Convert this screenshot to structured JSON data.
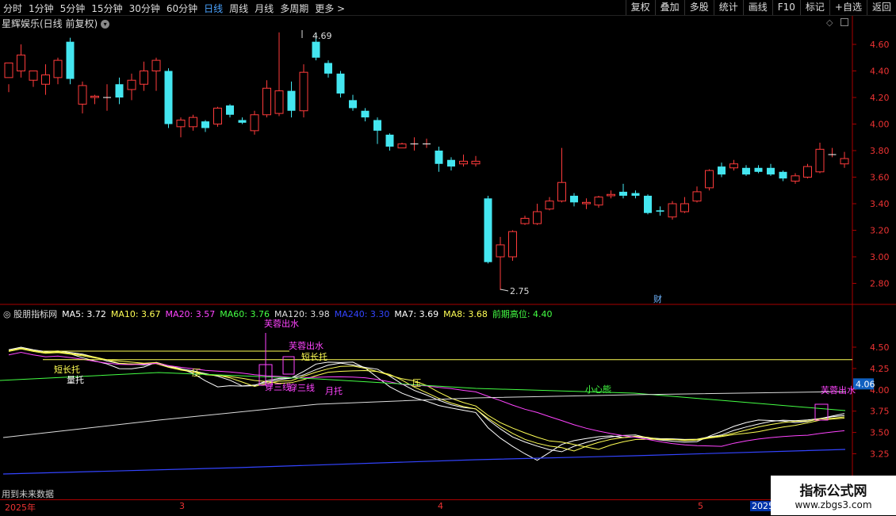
{
  "toolbar": {
    "periods": [
      "分时",
      "1分钟",
      "5分钟",
      "15分钟",
      "30分钟",
      "60分钟",
      "日线",
      "周线",
      "月线",
      "多周期",
      "更多 >"
    ],
    "active_index": 6,
    "right_buttons": [
      "复权",
      "叠加",
      "多股",
      "统计",
      "画线",
      "F10",
      "标记",
      "+自选",
      "返回"
    ]
  },
  "main_chart": {
    "title": "星辉娱乐(日线 前复权)",
    "y_ticks": [
      "4.60",
      "4.40",
      "4.20",
      "4.00",
      "3.80",
      "3.60",
      "3.40",
      "3.20",
      "3.00",
      "2.80"
    ],
    "high_label": "4.69",
    "low_label": "2.75",
    "fin_marker": "财",
    "candles": [
      [
        4.35,
        4.46,
        4.3,
        4.24
      ],
      [
        4.4,
        4.52,
        4.6,
        4.35
      ],
      [
        4.33,
        4.4,
        4.35,
        4.28
      ],
      [
        4.3,
        4.37,
        4.45,
        4.22
      ],
      [
        4.35,
        4.48,
        4.5,
        4.3
      ],
      [
        4.62,
        4.34,
        4.65,
        4.3
      ],
      [
        4.15,
        4.29,
        4.32,
        4.08
      ],
      [
        4.2,
        4.21,
        4.22,
        4.15
      ],
      [
        4.2,
        4.2,
        4.3,
        4.1
      ],
      [
        4.3,
        4.2,
        4.35,
        4.15
      ],
      [
        4.26,
        4.33,
        4.38,
        4.18
      ],
      [
        4.3,
        4.4,
        4.47,
        4.25
      ],
      [
        4.4,
        4.48,
        4.5,
        4.25
      ],
      [
        4.4,
        4.0,
        4.42,
        3.97
      ],
      [
        3.98,
        4.03,
        4.05,
        3.9
      ],
      [
        3.98,
        4.05,
        4.07,
        3.95
      ],
      [
        4.02,
        3.97,
        4.03,
        3.94
      ],
      [
        4.0,
        4.12,
        4.13,
        3.98
      ],
      [
        4.14,
        4.07,
        4.15,
        4.05
      ],
      [
        4.03,
        4.01,
        4.05,
        4.0
      ],
      [
        3.95,
        4.07,
        4.1,
        3.92
      ],
      [
        4.07,
        4.27,
        4.33,
        4.05
      ],
      [
        4.08,
        4.25,
        4.69,
        4.06
      ],
      [
        4.25,
        4.1,
        4.32,
        4.05
      ],
      [
        4.1,
        4.39,
        4.45,
        4.05
      ],
      [
        4.62,
        4.5,
        4.69,
        4.48
      ],
      [
        4.46,
        4.38,
        4.48,
        4.35
      ],
      [
        4.38,
        4.23,
        4.4,
        4.2
      ],
      [
        4.18,
        4.12,
        4.22,
        4.1
      ],
      [
        4.1,
        4.05,
        4.12,
        4.02
      ],
      [
        4.03,
        3.95,
        4.05,
        3.85
      ],
      [
        3.92,
        3.83,
        3.93,
        3.8
      ],
      [
        3.82,
        3.85,
        3.86,
        3.82
      ],
      [
        3.85,
        3.85,
        3.9,
        3.8
      ],
      [
        3.85,
        3.85,
        3.89,
        3.82
      ],
      [
        3.8,
        3.7,
        3.83,
        3.64
      ],
      [
        3.73,
        3.68,
        3.75,
        3.65
      ],
      [
        3.7,
        3.72,
        3.77,
        3.68
      ],
      [
        3.7,
        3.72,
        3.76,
        3.68
      ],
      [
        3.44,
        2.96,
        3.46,
        2.95
      ],
      [
        3.0,
        3.09,
        3.15,
        2.75
      ],
      [
        3.0,
        3.19,
        3.2,
        2.97
      ],
      [
        3.25,
        3.29,
        3.31,
        3.24
      ],
      [
        3.25,
        3.34,
        3.4,
        3.24
      ],
      [
        3.36,
        3.42,
        3.45,
        3.35
      ],
      [
        3.42,
        3.56,
        3.82,
        3.41
      ],
      [
        3.46,
        3.41,
        3.48,
        3.38
      ],
      [
        3.4,
        3.41,
        3.44,
        3.36
      ],
      [
        3.39,
        3.45,
        3.46,
        3.37
      ],
      [
        3.46,
        3.47,
        3.5,
        3.44
      ],
      [
        3.49,
        3.46,
        3.55,
        3.44
      ],
      [
        3.48,
        3.46,
        3.5,
        3.44
      ],
      [
        3.46,
        3.33,
        3.47,
        3.32
      ],
      [
        3.35,
        3.34,
        3.38,
        3.31
      ],
      [
        3.3,
        3.4,
        3.42,
        3.28
      ],
      [
        3.34,
        3.4,
        3.45,
        3.33
      ],
      [
        3.42,
        3.49,
        3.53,
        3.41
      ],
      [
        3.52,
        3.65,
        3.66,
        3.5
      ],
      [
        3.68,
        3.62,
        3.71,
        3.6
      ],
      [
        3.67,
        3.7,
        3.73,
        3.65
      ],
      [
        3.67,
        3.62,
        3.69,
        3.61
      ],
      [
        3.67,
        3.64,
        3.69,
        3.63
      ],
      [
        3.67,
        3.62,
        3.7,
        3.61
      ],
      [
        3.64,
        3.59,
        3.65,
        3.57
      ],
      [
        3.57,
        3.61,
        3.63,
        3.55
      ],
      [
        3.6,
        3.68,
        3.7,
        3.59
      ],
      [
        3.64,
        3.81,
        3.86,
        3.63
      ],
      [
        3.77,
        3.77,
        3.82,
        3.75
      ],
      [
        3.7,
        3.74,
        3.79,
        3.67
      ]
    ]
  },
  "indicator": {
    "name": "股朋指标网",
    "values": [
      {
        "label": "MA5: 3.72",
        "color": "#ffffff"
      },
      {
        "label": "MA10: 3.67",
        "color": "#ffff55"
      },
      {
        "label": "MA20: 3.57",
        "color": "#ff44ff"
      },
      {
        "label": "MA60: 3.76",
        "color": "#44ff44"
      },
      {
        "label": "MA120: 3.98",
        "color": "#dddddd"
      },
      {
        "label": "MA240: 3.30",
        "color": "#3344ff"
      },
      {
        "label": "MA7: 3.69",
        "color": "#ffffff"
      },
      {
        "label": "MA8: 3.68",
        "color": "#ffff55"
      },
      {
        "label": "前期高位: 4.40",
        "color": "#44ff44"
      }
    ],
    "y_ticks": [
      "4.50",
      "4.25",
      "4.00",
      "3.75",
      "3.50",
      "3.25"
    ],
    "current_value": "4.06",
    "annotations": [
      "芙蓉出水",
      "芙蓉出水",
      "短长托",
      "短长托",
      "量托",
      "压",
      "穿三线",
      "穿三线",
      "月托",
      "压",
      "小心熊",
      "芙蓉出水"
    ]
  },
  "date_axis": {
    "labels": [
      "2025年",
      "3",
      "4",
      "5",
      "2025"
    ]
  },
  "future_note": "用到未来数据",
  "watermark": {
    "line1": "指标公式网",
    "line2": "www.zbgs3.com"
  }
}
